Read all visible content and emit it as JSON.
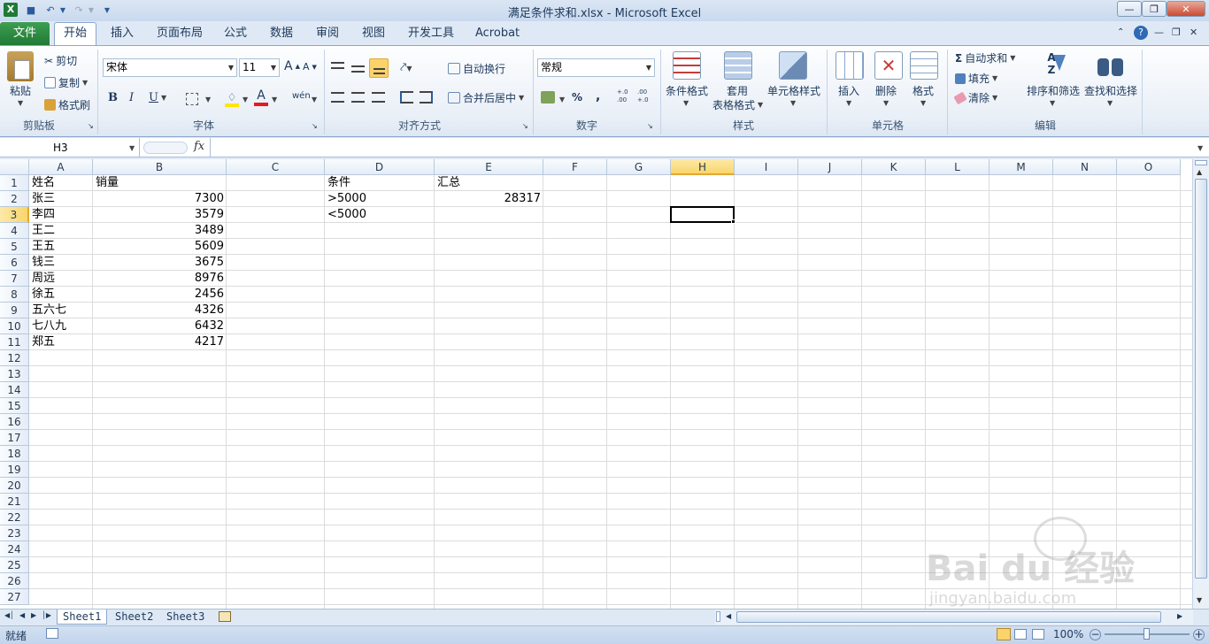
{
  "window": {
    "title": "满足条件求和.xlsx - Microsoft Excel"
  },
  "ribbon_tabs": [
    "文件",
    "开始",
    "插入",
    "页面布局",
    "公式",
    "数据",
    "审阅",
    "视图",
    "开发工具",
    "Acrobat"
  ],
  "clipboard": {
    "paste": "粘贴",
    "cut": "剪切",
    "copy": "复制",
    "format_painter": "格式刷",
    "label": "剪贴板"
  },
  "font": {
    "name": "宋体",
    "size": "11",
    "bold": "B",
    "italic": "I",
    "underline": "U",
    "grow": "A",
    "shrink": "A",
    "color_a": "A",
    "wen": "wén",
    "label": "字体"
  },
  "alignment": {
    "wrap": "自动换行",
    "merge": "合并后居中",
    "label": "对齐方式"
  },
  "number": {
    "format": "常规",
    "percent": "%",
    "comma": ",",
    "inc": "+.0 .00",
    "dec": ".00 +.0",
    "label": "数字"
  },
  "styles": {
    "conditional": "条件格式",
    "table_line1": "套用",
    "table_line2": "表格格式",
    "cell_styles": "单元格样式",
    "label": "样式"
  },
  "cells_group": {
    "insert": "插入",
    "delete": "删除",
    "format": "格式",
    "label": "单元格"
  },
  "editing": {
    "autosum": "自动求和",
    "fill": "填充",
    "clear": "清除",
    "sort": "排序和筛选",
    "find": "查找和选择",
    "label": "编辑",
    "sigma": "Σ"
  },
  "formula": {
    "name_box": "H3",
    "fx": "fx",
    "value": ""
  },
  "columns": [
    "A",
    "B",
    "C",
    "D",
    "E",
    "F",
    "G",
    "H",
    "I",
    "J",
    "K",
    "L",
    "M",
    "N",
    "O"
  ],
  "rows": [
    "1",
    "2",
    "3",
    "4",
    "5",
    "6",
    "7",
    "8",
    "9",
    "10",
    "11",
    "12",
    "13",
    "14",
    "15",
    "16",
    "17",
    "18",
    "19",
    "20",
    "21",
    "22",
    "23",
    "24",
    "25",
    "26",
    "27"
  ],
  "cells": {
    "A": [
      "姓名",
      "张三",
      "李四",
      "王二",
      "王五",
      "钱三",
      "周远",
      "徐五",
      "五六七",
      "七八九",
      "郑五"
    ],
    "B": [
      "销量",
      "7300",
      "3579",
      "3489",
      "5609",
      "3675",
      "8976",
      "2456",
      "4326",
      "6432",
      "4217"
    ],
    "D": [
      "条件",
      ">5000",
      "<5000"
    ],
    "E": [
      "汇总",
      "28317"
    ]
  },
  "sheets": [
    "Sheet1",
    "Sheet2",
    "Sheet3"
  ],
  "status": {
    "ready": "就绪",
    "zoom": "100%"
  },
  "watermark": {
    "line1": "Bai du 经验",
    "line2": "jingyan.baidu.com"
  }
}
